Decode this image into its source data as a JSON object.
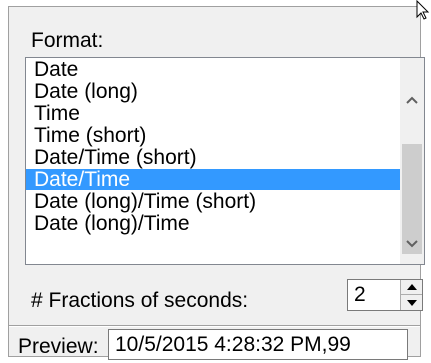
{
  "format": {
    "label": "Format:",
    "items": [
      "Date",
      "Date (long)",
      "Time",
      "Time (short)",
      "Date/Time (short)",
      "Date/Time",
      "Date (long)/Time (short)",
      "Date (long)/Time"
    ],
    "selected_item": "Date/Time"
  },
  "fractions": {
    "label": "# Fractions of seconds:",
    "value": "2"
  },
  "preview": {
    "label": "Preview:",
    "value": "10/5/2015 4:28:32 PM,99"
  },
  "icons": {
    "scroll_up": "chevron-up-icon",
    "scroll_down": "chevron-down-icon",
    "spin_up": "triangle-up-icon",
    "spin_down": "triangle-down-icon",
    "cursor": "mouse-cursor-icon"
  },
  "colors": {
    "selection": "#3399ff",
    "panel_bg": "#f0f0f0"
  }
}
